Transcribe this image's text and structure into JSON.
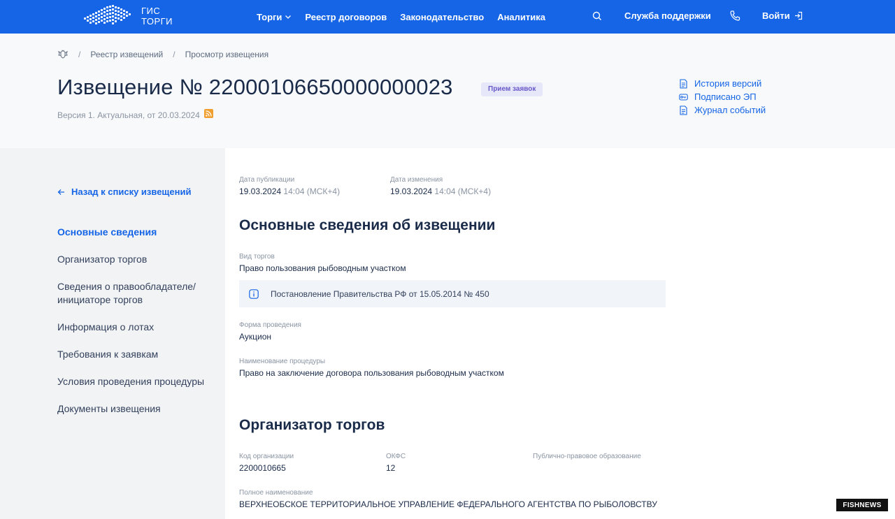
{
  "topbar": {
    "logo_line1": "ГИС",
    "logo_line2": "ТОРГИ",
    "nav": [
      "Торги",
      "Реестр договоров",
      "Законодательство",
      "Аналитика"
    ],
    "support": "Служба поддержки",
    "login": "Войти"
  },
  "breadcrumb": {
    "items": [
      "Реестр извещений",
      "Просмотр извещения"
    ],
    "separator": "/"
  },
  "header": {
    "title": "Извещение № 22000106650000000023",
    "status": "Прием заявок",
    "version": "Версия 1. Актуальная, от 20.03.2024",
    "links": [
      "История версий",
      "Подписано ЭП",
      "Журнал событий"
    ]
  },
  "sidebar": {
    "back": "Назад к списку извещений",
    "items": [
      "Основные сведения",
      "Организатор торгов",
      "Сведения о правообладателе/ инициаторе торгов",
      "Информация о лотах",
      "Требования к заявкам",
      "Условия проведения процедуры",
      "Документы извещения"
    ],
    "active_index": 0
  },
  "dates": {
    "published_label": "Дата публикации",
    "published_date": "19.03.2024",
    "published_time": "14:04 (МСК+4)",
    "changed_label": "Дата изменения",
    "changed_date": "19.03.2024",
    "changed_time": "14:04 (МСК+4)"
  },
  "basic": {
    "title": "Основные сведения об извещении",
    "type_label": "Вид торгов",
    "type_value": "Право пользования рыбоводным участком",
    "info_note": "Постановление Правительства РФ от 15.05.2014 № 450",
    "form_label": "Форма проведения",
    "form_value": "Аукцион",
    "procedure_label": "Наименование процедуры",
    "procedure_value": "Право на заключение договора пользования рыбоводным участком"
  },
  "organizer": {
    "title": "Организатор торгов",
    "code_label": "Код организации",
    "code_value": "2200010665",
    "okfs_label": "ОКФС",
    "okfs_value": "12",
    "public_label": "Публично-правовое образование",
    "fullname_label": "Полное наименование",
    "fullname_value": "ВЕРХНЕОБСКОЕ ТЕРРИТОРИАЛЬНОЕ УПРАВЛЕНИЕ ФЕДЕРАЛЬНОГО АГЕНТСТВА ПО РЫБОЛОВСТВУ"
  },
  "watermark": {
    "part1": "FISH",
    "part2": "NEWS"
  },
  "colors": {
    "primary": "#1565e6",
    "badge_bg": "#e6e8f9",
    "badge_text": "#6a58c9",
    "rss": "#f0a030"
  }
}
